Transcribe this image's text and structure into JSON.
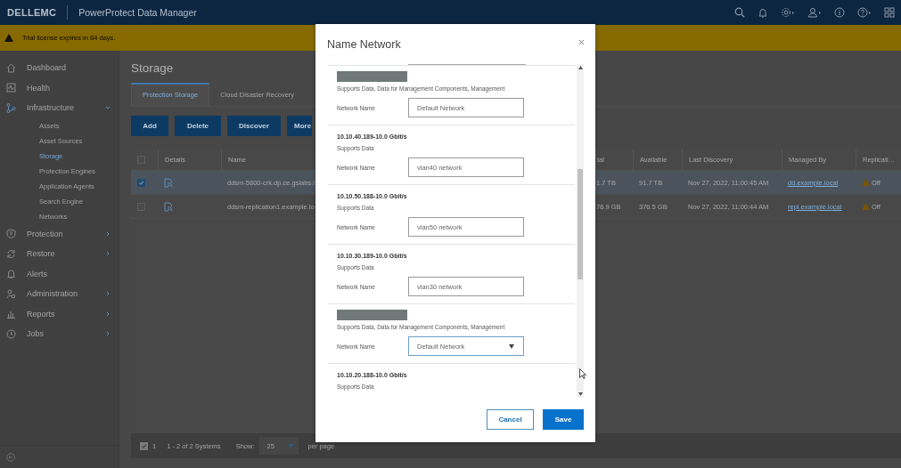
{
  "header": {
    "logo": "DELLEMC",
    "product": "PowerProtect Data Manager"
  },
  "banner": {
    "message": "Trial license expires in 84 days."
  },
  "sidebar": {
    "items": [
      {
        "label": "Dashboard",
        "expandable": false
      },
      {
        "label": "Health",
        "expandable": false
      },
      {
        "label": "Infrastructure",
        "expandable": true,
        "expanded": true,
        "children": [
          {
            "label": "Assets",
            "selected": false
          },
          {
            "label": "Asset Sources",
            "selected": false
          },
          {
            "label": "Storage",
            "selected": true
          },
          {
            "label": "Protection Engines",
            "selected": false
          },
          {
            "label": "Application Agents",
            "selected": false
          },
          {
            "label": "Search Engine",
            "selected": false
          },
          {
            "label": "Networks",
            "selected": false
          }
        ]
      },
      {
        "label": "Protection",
        "expandable": true,
        "expanded": false
      },
      {
        "label": "Restore",
        "expandable": true,
        "expanded": false
      },
      {
        "label": "Alerts",
        "expandable": false
      },
      {
        "label": "Administration",
        "expandable": true,
        "expanded": false
      },
      {
        "label": "Reports",
        "expandable": true,
        "expanded": false
      },
      {
        "label": "Jobs",
        "expandable": true,
        "expanded": false
      }
    ]
  },
  "page": {
    "title": "Storage",
    "tabs": [
      {
        "label": "Protection Storage",
        "selected": true
      },
      {
        "label": "Cloud Disaster Recovery",
        "selected": false
      }
    ],
    "actions": [
      "Add",
      "Delete",
      "Discover",
      "More"
    ],
    "table": {
      "all_checked": false,
      "columns": [
        "Details",
        "Name",
        "tal",
        "Available",
        "Last Discovery",
        "Managed By",
        "Replicati…"
      ],
      "rows": [
        {
          "selected": true,
          "name": "ddsm-5800-crk.dp.ce.gslabs.l",
          "total": "1.7 TB",
          "available": "91.7 TB",
          "last_discovery": "Nov 27, 2022, 11:00:45 AM",
          "managed_by": "dd.example.local",
          "replication": "Off"
        },
        {
          "selected": false,
          "name": "ddsm-replication1.example.lo",
          "total": "76.9 GB",
          "available": "376.5 GB",
          "last_discovery": "Nov 27, 2022, 11:00:44 AM",
          "managed_by": "repl.example.local",
          "replication": "Off"
        }
      ]
    },
    "footer": {
      "checked": true,
      "selected_count": "1",
      "range": "1 - 2 of 2 Systems",
      "show_label": "Show:",
      "page_size": "25",
      "per_page": "per page"
    }
  },
  "dialog": {
    "title": "Name Network",
    "sections": [
      {
        "redacted": true,
        "supports": "Supports Data, Data for Management Components, Management",
        "label": "Network Name",
        "field": {
          "kind": "input",
          "value": "Default Network"
        }
      },
      {
        "redacted": false,
        "title": "10.10.40.189-10.0 Gbit/s",
        "supports": "Supports Data",
        "label": "Network Name",
        "field": {
          "kind": "input",
          "value": "vlan40 network"
        }
      },
      {
        "redacted": false,
        "title": "10.10.50.188-10.0 Gbit/s",
        "supports": "Supports Data",
        "label": "Network Name",
        "field": {
          "kind": "input",
          "value": "vlan50 network"
        }
      },
      {
        "redacted": false,
        "title": "10.10.30.189-10.0 Gbit/s",
        "supports": "Supports Data",
        "label": "Network Name",
        "field": {
          "kind": "input",
          "value": "vlan30 network"
        }
      },
      {
        "redacted": true,
        "supports": "Supports Data, Data for Management Components, Management",
        "label": "Network Name",
        "field": {
          "kind": "select",
          "value": "Default Network"
        }
      },
      {
        "redacted": false,
        "title": "10.10.20.188-10.0 Gbit/s",
        "supports": "Supports Data"
      }
    ],
    "buttons": [
      {
        "label": "Cancel",
        "kind": "secondary"
      },
      {
        "label": "Save",
        "kind": "primary"
      }
    ]
  }
}
